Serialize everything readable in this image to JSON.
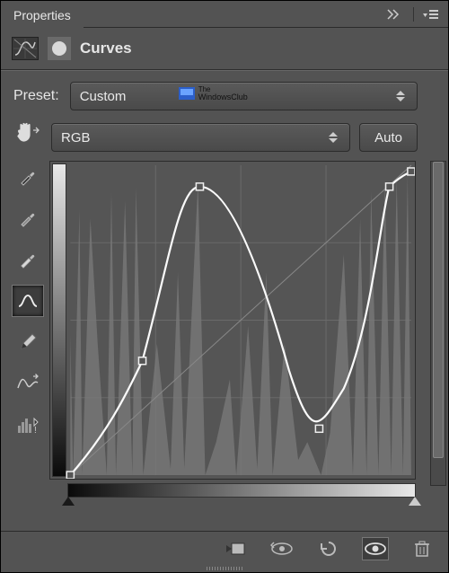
{
  "panel": {
    "title": "Properties",
    "adjustment_name": "Curves"
  },
  "preset": {
    "label": "Preset:",
    "value": "Custom"
  },
  "channel": {
    "value": "RGB"
  },
  "buttons": {
    "auto": "Auto"
  },
  "watermark": {
    "line1": "The",
    "line2": "WindowsClub"
  },
  "tools": {
    "finger": "on-image-adjust",
    "eyedrop_black": "black-point",
    "eyedrop_gray": "gray-point",
    "eyedrop_white": "white-point",
    "curve": "edit-curve-points",
    "pencil": "draw-curve",
    "smooth": "smooth-curve",
    "histogram_toggle": "histogram-options"
  },
  "footer_icons": {
    "clip": "clip-to-layer",
    "view_prev": "view-previous-state",
    "reset": "reset-to-default",
    "visibility": "toggle-visibility",
    "delete": "delete-adjustment"
  },
  "curve_points": [
    {
      "x": 0,
      "y": 1.0
    },
    {
      "x": 0.21,
      "y": 0.63
    },
    {
      "x": 0.38,
      "y": 0.07
    },
    {
      "x": 0.73,
      "y": 0.85
    },
    {
      "x": 0.935,
      "y": 0.07
    },
    {
      "x": 1.0,
      "y": 0.02
    }
  ]
}
